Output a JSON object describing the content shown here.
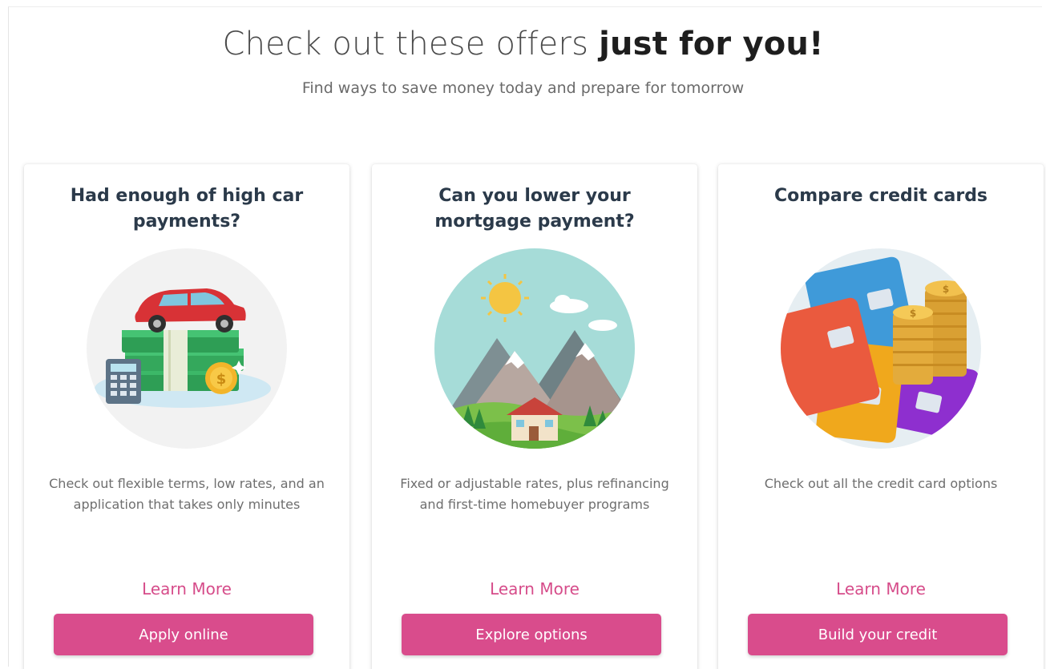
{
  "header": {
    "title_light": "Check out these offers ",
    "title_bold": "just for you!",
    "subtitle": "Find ways to save money today and prepare for tomorrow"
  },
  "cards": [
    {
      "title": "Had enough of high car payments?",
      "illustration_icon": "car-money-illustration",
      "description": "Check out flexible terms, low rates, and an application that takes only minutes",
      "link": "Learn More",
      "button": "Apply online"
    },
    {
      "title": "Can you lower your mortgage payment?",
      "illustration_icon": "mountain-house-illustration",
      "description": "Fixed or adjustable rates, plus refinancing and first-time homebuyer programs",
      "link": "Learn More",
      "button": "Explore options"
    },
    {
      "title": "Compare credit cards",
      "illustration_icon": "credit-cards-coins-illustration",
      "description": "Check out all the credit card options",
      "link": "Learn More",
      "button": "Build your credit"
    }
  ],
  "colors": {
    "accent": "#d94c8c",
    "link": "#d64c8a",
    "title": "#2b3a4a"
  }
}
